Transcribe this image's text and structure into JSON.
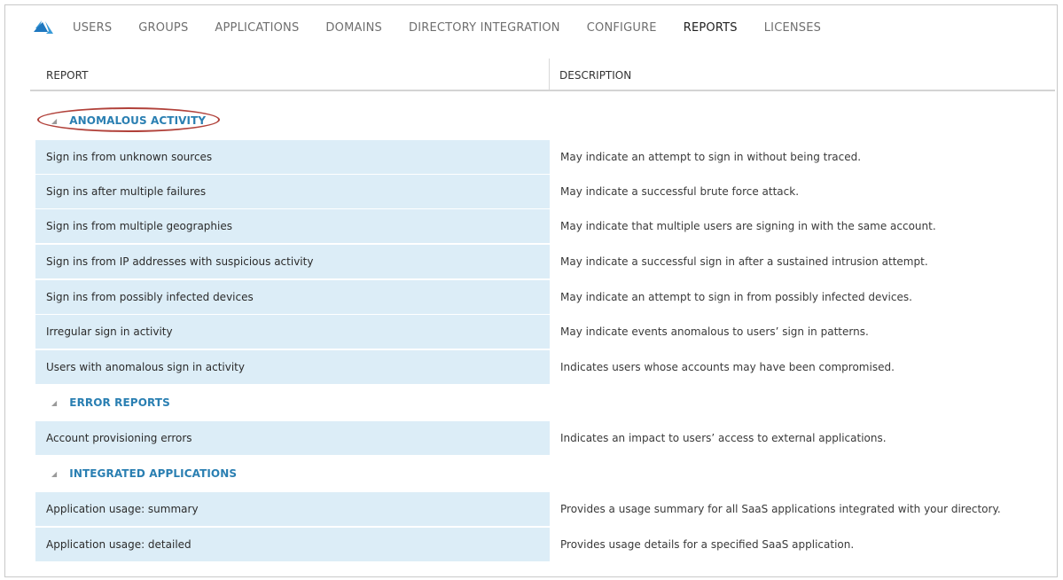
{
  "nav": {
    "logo": "azure-ad-icon",
    "items": [
      {
        "label": "USERS",
        "active": false
      },
      {
        "label": "GROUPS",
        "active": false
      },
      {
        "label": "APPLICATIONS",
        "active": false
      },
      {
        "label": "DOMAINS",
        "active": false
      },
      {
        "label": "DIRECTORY INTEGRATION",
        "active": false
      },
      {
        "label": "CONFIGURE",
        "active": false
      },
      {
        "label": "REPORTS",
        "active": true
      },
      {
        "label": "LICENSES",
        "active": false
      }
    ]
  },
  "table": {
    "col_report": "REPORT",
    "col_description": "DESCRIPTION",
    "groups": [
      {
        "title": "ANOMALOUS ACTIVITY",
        "highlighted": true,
        "rows": [
          {
            "name": "Sign ins from unknown sources",
            "desc": "May indicate an attempt to sign in without being traced."
          },
          {
            "name": "Sign ins after multiple failures",
            "desc": "May indicate a successful brute force attack."
          },
          {
            "name": "Sign ins from multiple geographies",
            "desc": "May indicate that multiple users are signing in with the same account."
          },
          {
            "name": "Sign ins from IP addresses with suspicious activity",
            "desc": "May indicate a successful sign in after a sustained intrusion attempt."
          },
          {
            "name": "Sign ins from possibly infected devices",
            "desc": "May indicate an attempt to sign in from possibly infected devices."
          },
          {
            "name": "Irregular sign in activity",
            "desc": "May indicate events anomalous to users’ sign in patterns."
          },
          {
            "name": "Users with anomalous sign in activity",
            "desc": "Indicates users whose accounts may have been compromised."
          }
        ]
      },
      {
        "title": "ERROR REPORTS",
        "highlighted": false,
        "rows": [
          {
            "name": "Account provisioning errors",
            "desc": "Indicates an impact to users’ access to external applications."
          }
        ]
      },
      {
        "title": "INTEGRATED APPLICATIONS",
        "highlighted": false,
        "rows": [
          {
            "name": "Application usage: summary",
            "desc": "Provides a usage summary for all SaaS applications integrated with your directory."
          },
          {
            "name": "Application usage: detailed",
            "desc": "Provides usage details for a specified SaaS application."
          }
        ]
      }
    ]
  },
  "colors": {
    "accent": "#2a7fb2",
    "row_bg": "#dcedf7",
    "highlight_oval": "#b1413a"
  }
}
